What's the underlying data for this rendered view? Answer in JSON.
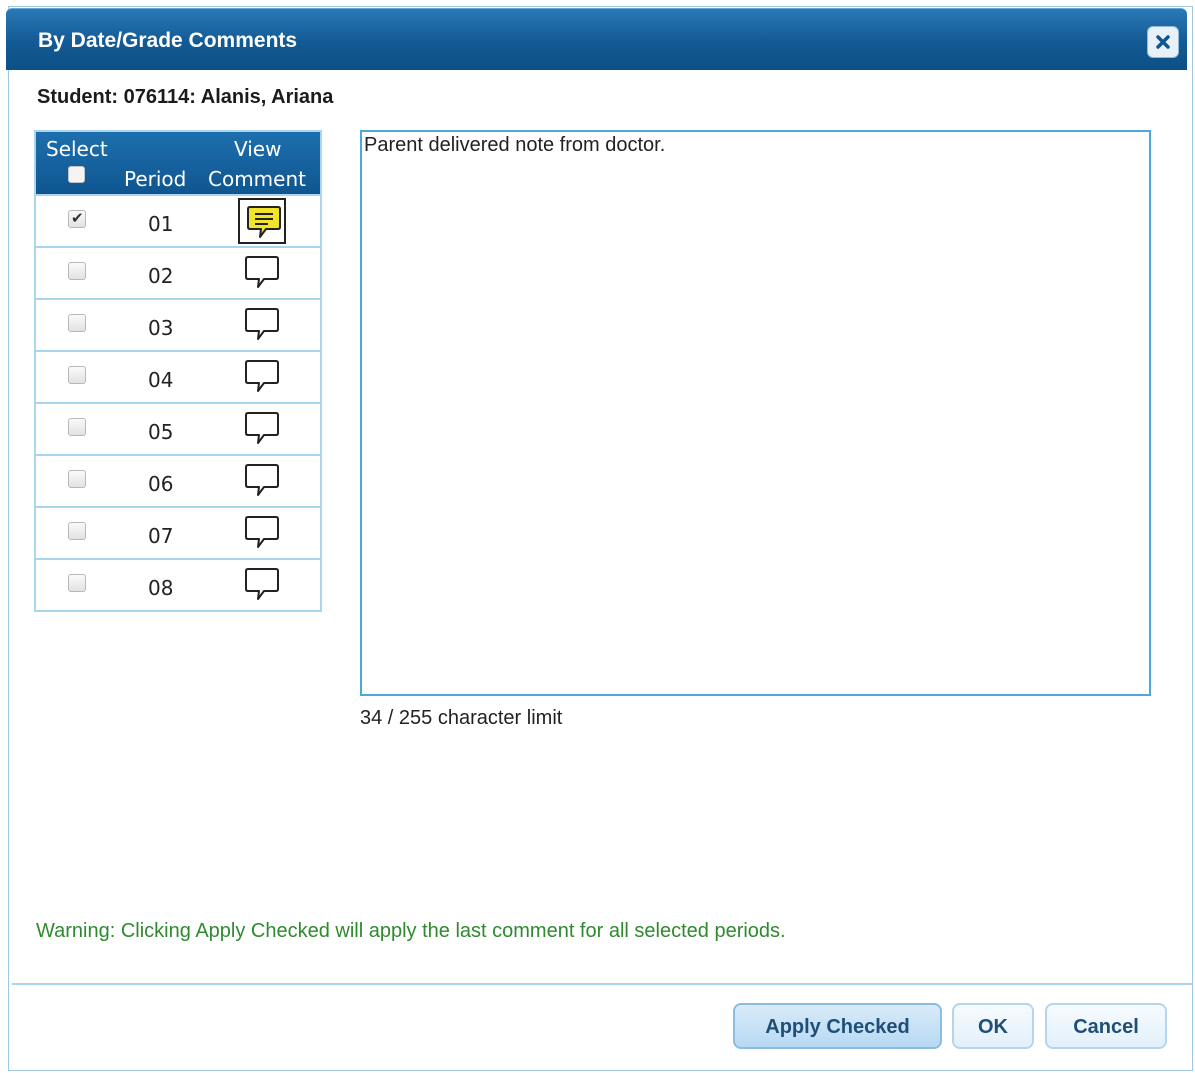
{
  "dialog": {
    "title": "By Date/Grade Comments",
    "close_icon": "close-icon"
  },
  "student_label": "Student: 076114: Alanis, Ariana",
  "table": {
    "header": {
      "select": "Select",
      "period": "Period",
      "view": "View",
      "comment": "Comment"
    },
    "rows": [
      {
        "period": "01",
        "checked": true,
        "has_comment": true
      },
      {
        "period": "02",
        "checked": false,
        "has_comment": false
      },
      {
        "period": "03",
        "checked": false,
        "has_comment": false
      },
      {
        "period": "04",
        "checked": false,
        "has_comment": false
      },
      {
        "period": "05",
        "checked": false,
        "has_comment": false
      },
      {
        "period": "06",
        "checked": false,
        "has_comment": false
      },
      {
        "period": "07",
        "checked": false,
        "has_comment": false
      },
      {
        "period": "08",
        "checked": false,
        "has_comment": false
      }
    ]
  },
  "comment": {
    "text": "Parent delivered note from doctor.",
    "char_limit": "34 / 255 character limit"
  },
  "warning": "Warning: Clicking Apply Checked will apply the last comment for all selected periods.",
  "buttons": {
    "apply_checked": "Apply Checked",
    "ok": "OK",
    "cancel": "Cancel"
  },
  "colors": {
    "title_bar": "#135a94",
    "warning": "#2f8a2f",
    "comment_icon_active": "#f1e42a"
  }
}
